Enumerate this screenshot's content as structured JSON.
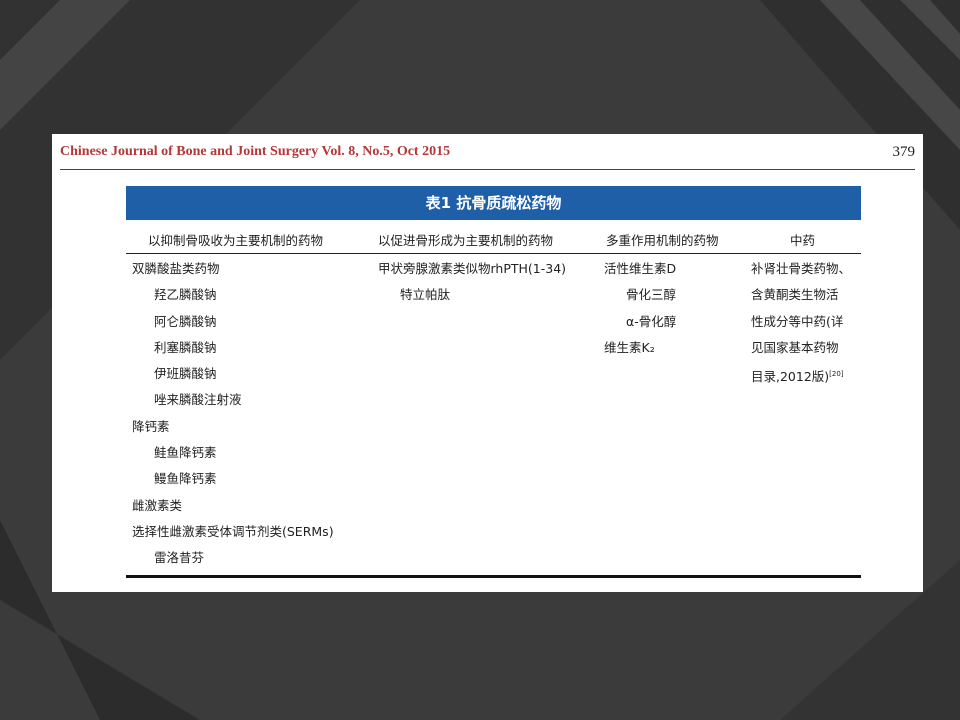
{
  "header": {
    "journal": "Chinese Journal of Bone and Joint Surgery   Vol. 8, No.5, Oct 2015",
    "page": "379"
  },
  "table": {
    "title": "表1  抗骨质疏松药物",
    "columns": [
      "以抑制骨吸收为主要机制的药物",
      "以促进骨形成为主要机制的药物",
      "多重作用机制的药物",
      "中药"
    ],
    "col1": [
      "双膦酸盐类药物",
      "羟乙膦酸钠",
      "阿仑膦酸钠",
      "利塞膦酸钠",
      "伊班膦酸钠",
      "唑来膦酸注射液",
      "降钙素",
      "鲑鱼降钙素",
      "鳗鱼降钙素",
      "雌激素类",
      "选择性雌激素受体调节剂类(SERMs)",
      "雷洛昔芬"
    ],
    "col2": [
      "甲状旁腺激素类似物rhPTH(1-34)",
      "特立帕肽"
    ],
    "col3": [
      "活性维生素D",
      "骨化三醇",
      "α-骨化醇",
      "维生素K₂"
    ],
    "col4": [
      "补肾壮骨类药物、",
      "含黄酮类生物活",
      "性成分等中药(详",
      "见国家基本药物",
      "目录,2012版)",
      "[20]"
    ]
  }
}
